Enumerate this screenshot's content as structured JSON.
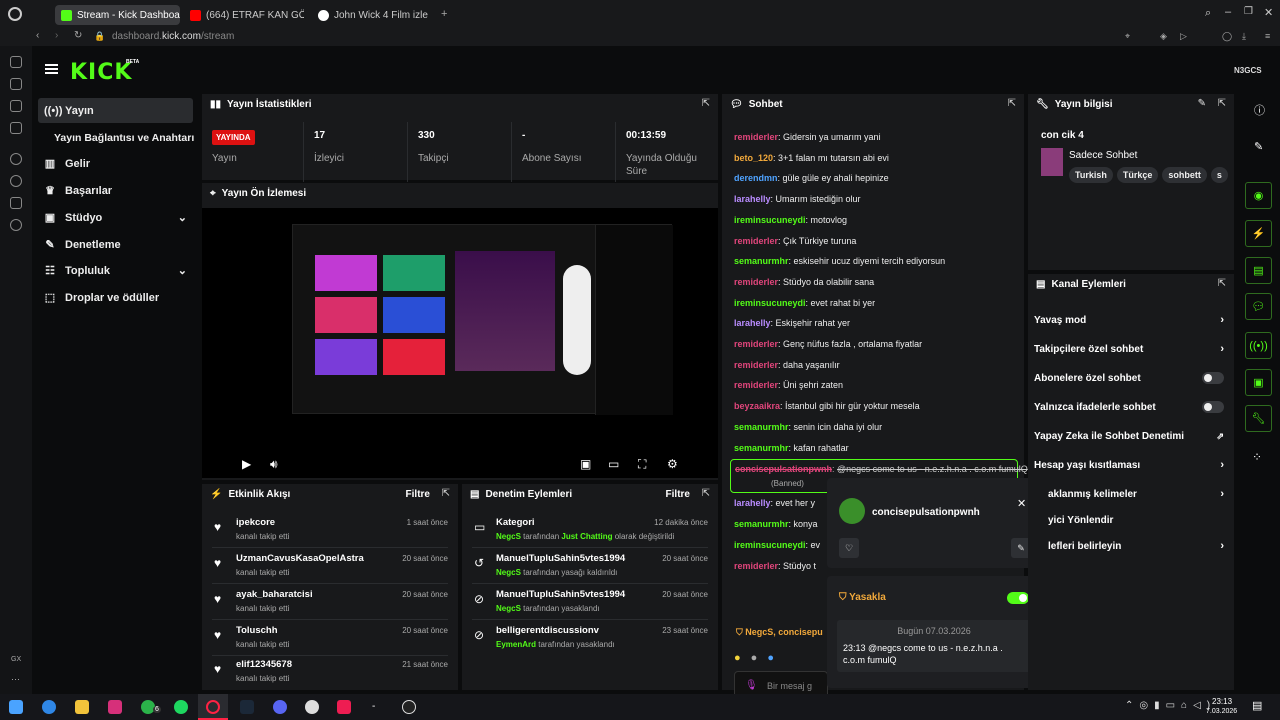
{
  "browser": {
    "tabs": [
      {
        "title": "Stream - Kick Dashboard",
        "color": "#53fc18"
      },
      {
        "title": "(664) ETRAF KAN GÖLÜ!",
        "color": "#ff0000"
      },
      {
        "title": "John Wick 4 Film izle",
        "color": "#ffffff"
      }
    ],
    "url_prefix": "dashboard.",
    "url_domain": "kick.com",
    "url_path": "/stream"
  },
  "app": {
    "logo": "KICK",
    "logo_badge": "BETA",
    "user_tag": "N3GCS",
    "accent": "#53fc18"
  },
  "sidebar": {
    "items": [
      {
        "label": "Yayın",
        "icon": "broadcast-icon"
      },
      {
        "label": "Yayın Bağlantısı ve Anahtarı",
        "icon": ""
      },
      {
        "label": "Gelir",
        "icon": "revenue-icon"
      },
      {
        "label": "Başarılar",
        "icon": "trophy-icon"
      },
      {
        "label": "Stüdyo",
        "icon": "studio-icon"
      },
      {
        "label": "Denetleme",
        "icon": "wrench-icon"
      },
      {
        "label": "Topluluk",
        "icon": "community-icon"
      },
      {
        "label": "Droplar ve ödüller",
        "icon": "drops-icon"
      }
    ]
  },
  "stats": {
    "title": "Yayın İstatistikleri",
    "live_badge": "YAYINDA",
    "items": [
      {
        "value": "",
        "label": "Yayın"
      },
      {
        "value": "17",
        "label": "İzleyici"
      },
      {
        "value": "330",
        "label": "Takipçi"
      },
      {
        "value": "-",
        "label": "Abone Sayısı"
      },
      {
        "value": "00:13:59",
        "label": "Yayında Olduğu Süre"
      }
    ]
  },
  "preview": {
    "title": "Yayın Ön İzlemesi"
  },
  "activity": {
    "title": "Etkinlik Akışı",
    "filter": "Filtre",
    "rows": [
      {
        "name": "ipekcore",
        "sub": "kanalı takip etti",
        "time": "1 saat önce"
      },
      {
        "name": "UzmanCavusKasaOpelAstra",
        "sub": "kanalı takip etti",
        "time": "20 saat önce"
      },
      {
        "name": "ayak_baharatcisi",
        "sub": "kanalı takip etti",
        "time": "20 saat önce"
      },
      {
        "name": "Toluschh",
        "sub": "kanalı takip etti",
        "time": "20 saat önce"
      },
      {
        "name": "elif12345678",
        "sub": "kanalı takip etti",
        "time": "21 saat önce"
      }
    ]
  },
  "moderation": {
    "title": "Denetim Eylemleri",
    "filter": "Filtre",
    "rows": [
      {
        "name": "Kategori",
        "actor": "NegcS",
        "mid": " tarafından ",
        "hl": "Just Chatting",
        "end": " olarak değiştirildi",
        "time": "12 dakika önce"
      },
      {
        "name": "ManuelTupluSahin5vtes1994",
        "actor": "NegcS",
        "mid": " tarafından yasağı kaldırıldı",
        "hl": "",
        "end": "",
        "time": "20 saat önce"
      },
      {
        "name": "ManuelTupluSahin5vtes1994",
        "actor": "NegcS",
        "mid": " tarafından yasaklandı",
        "hl": "",
        "end": "",
        "time": "20 saat önce"
      },
      {
        "name": "belligerentdiscussionv",
        "actor": "EymenArd",
        "mid": " tarafından yasaklandı",
        "hl": "",
        "end": "",
        "time": "23 saat önce"
      }
    ]
  },
  "chat": {
    "title": "Sohbet",
    "messages": [
      {
        "user": "remiderler",
        "color": "#e0457b",
        "text": "Gidersin ya umarım yani"
      },
      {
        "user": "beto_120",
        "color": "#f2a93b",
        "text": "3+1 falan mı tutarsın abi evi"
      },
      {
        "user": "derendmn",
        "color": "#4fa3ff",
        "text": "güle güle ey ahali hepinize"
      },
      {
        "user": "larahelly",
        "color": "#b98cff",
        "text": "Umarım istediğin olur"
      },
      {
        "user": "ireminsucuneydi",
        "color": "#53fc18",
        "text": "motovlog"
      },
      {
        "user": "remiderler",
        "color": "#e0457b",
        "text": "Çık Türkiye turuna"
      },
      {
        "user": "semanurmhr",
        "color": "#53fc18",
        "text": "eskisehir ucuz diyemi tercih ediyorsun"
      },
      {
        "user": "remiderler",
        "color": "#e0457b",
        "text": "Stüdyo da olabilir sana"
      },
      {
        "user": "ireminsucuneydi",
        "color": "#53fc18",
        "text": "evet rahat bi yer"
      },
      {
        "user": "larahelly",
        "color": "#b98cff",
        "text": "Eskişehir rahat yer"
      },
      {
        "user": "remiderler",
        "color": "#e0457b",
        "text": "Genç nüfus fazla , ortalama fiyatlar"
      },
      {
        "user": "remiderler",
        "color": "#e0457b",
        "text": "daha yaşanılır"
      },
      {
        "user": "remiderler",
        "color": "#e0457b",
        "text": "Üni şehri zaten"
      },
      {
        "user": "beyzaaikra",
        "color": "#e0457b",
        "text": "İstanbul gibi hir gür yoktur mesela"
      },
      {
        "user": "semanurmhr",
        "color": "#53fc18",
        "text": "senin icin daha iyi olur"
      },
      {
        "user": "semanurmhr",
        "color": "#53fc18",
        "text": "kafan rahatlar"
      }
    ],
    "banned": {
      "user": "concisepulsationpwnh",
      "text": "@negcs come to us - n.e.z.h.n.a . c.o.m fumulQ",
      "tag": "(Banned)"
    },
    "partial": [
      {
        "user": "larahelly",
        "color": "#b98cff",
        "text": "evet her y"
      },
      {
        "user": "semanurmhr",
        "color": "#53fc18",
        "text": "konya"
      },
      {
        "user": "ireminsucuneydi",
        "color": "#53fc18",
        "text": "ev"
      },
      {
        "user": "remiderler",
        "color": "#e0457b",
        "text": "Stüdyo t"
      }
    ],
    "mod_line": "NegcS, concisepu",
    "placeholder": "Bir mesaj g"
  },
  "popup": {
    "username": "concisepulsationpwnh",
    "ban_label": "Yasakla",
    "date_label": "Bugün 07.03.2026",
    "message": "23:13 @negcs come to us - n.e.z.h.n.a . c.o.m fumulQ"
  },
  "info": {
    "title": "Yayın bilgisi",
    "stream_title": "con cik 4",
    "category": "Sadece Sohbet",
    "tags": [
      "Turkish",
      "Türkçe",
      "sohbett",
      "s"
    ]
  },
  "actions": {
    "title": "Kanal Eylemleri",
    "items": [
      {
        "label": "Yavaş mod",
        "kind": "arrow"
      },
      {
        "label": "Takipçilere özel sohbet",
        "kind": "arrow"
      },
      {
        "label": "Abonelere özel sohbet",
        "kind": "toggle"
      },
      {
        "label": "Yalnızca ifadelerle sohbet",
        "kind": "toggle"
      },
      {
        "label": "Yapay Zeka ile Sohbet Denetimi",
        "kind": "external"
      },
      {
        "label": "Hesap yaşı kısıtlaması",
        "kind": "arrow"
      },
      {
        "label": "aklanmış kelimeler",
        "kind": "arrow"
      },
      {
        "label": "yici Yönlendir",
        "kind": "none"
      },
      {
        "label": "lefleri belirleyin",
        "kind": "arrow"
      }
    ]
  },
  "taskbar": {
    "time": "23:13",
    "date": "7.03.2026",
    "badge": "6"
  },
  "gx_label": "GX"
}
